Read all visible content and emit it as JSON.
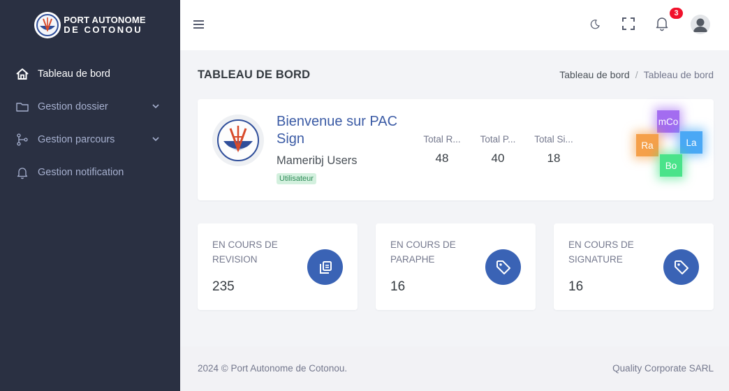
{
  "brand": {
    "line1": "PORT AUTONOME",
    "line2": "DE COTONOU"
  },
  "sidebar": {
    "items": [
      {
        "label": "Tableau de bord",
        "icon": "home-icon",
        "active": true
      },
      {
        "label": "Gestion dossier",
        "icon": "folder-icon",
        "has_submenu": true
      },
      {
        "label": "Gestion parcours",
        "icon": "branch-icon",
        "has_submenu": true
      },
      {
        "label": "Gestion notification",
        "icon": "bell-icon"
      }
    ]
  },
  "header": {
    "notification_count": "3",
    "icons": [
      "menu-icon",
      "moon-icon",
      "fullscreen-icon",
      "bell-icon",
      "user-avatar"
    ]
  },
  "page": {
    "title": "TABLEAU DE BORD",
    "breadcrumb": [
      "Tableau de bord",
      "Tableau de bord"
    ]
  },
  "welcome": {
    "title": "Bienvenue sur PAC Sign",
    "user": "Mameribj Users",
    "role": "Utilisateur",
    "stats": [
      {
        "label": "Total R...",
        "value": "48"
      },
      {
        "label": "Total P...",
        "value": "40"
      },
      {
        "label": "Total Si...",
        "value": "18"
      }
    ],
    "tiles": [
      {
        "label": "mCo",
        "color": "#a36cf0"
      },
      {
        "label": "Ra",
        "color": "#f5a04a"
      },
      {
        "label": "La",
        "color": "#4aa8f5"
      },
      {
        "label": "Bo",
        "color": "#4ae38a"
      }
    ]
  },
  "cards": [
    {
      "label": "EN COURS DE REVISION",
      "value": "235",
      "icon": "copy-icon"
    },
    {
      "label": "EN COURS DE PARAPHE",
      "value": "16",
      "icon": "tag-icon"
    },
    {
      "label": "EN COURS DE SIGNATURE",
      "value": "16",
      "icon": "tag-icon"
    }
  ],
  "footer": {
    "left": "2024 © Port Autonome de Cotonou.",
    "right": "Quality Corporate SARL"
  },
  "colors": {
    "sidebar_bg": "#2a3042",
    "accent": "#3a63b5",
    "title_blue": "#3b5ba5",
    "badge_red": "#f1112b"
  }
}
